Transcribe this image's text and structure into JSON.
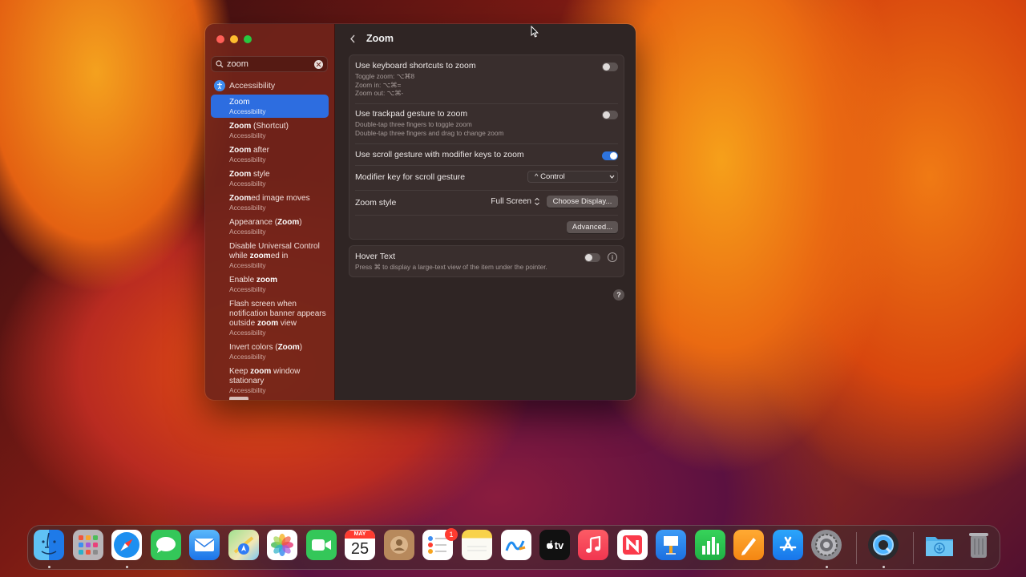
{
  "sidebar": {
    "search": {
      "value": "zoom",
      "placeholder": "Search"
    },
    "category": "Accessibility",
    "results": [
      {
        "title_parts": [
          "Zoom"
        ],
        "bold_idx": [],
        "subtitle": "Accessibility",
        "selected": true
      },
      {
        "title_parts": [
          "Zoom",
          " (Shortcut)"
        ],
        "bold_idx": [
          0
        ],
        "subtitle": "Accessibility"
      },
      {
        "title_parts": [
          "Zoom",
          " after"
        ],
        "bold_idx": [
          0
        ],
        "subtitle": "Accessibility"
      },
      {
        "title_parts": [
          "Zoom",
          " style"
        ],
        "bold_idx": [
          0
        ],
        "subtitle": "Accessibility"
      },
      {
        "title_parts": [
          "Zoom",
          "ed image moves"
        ],
        "bold_idx": [
          0
        ],
        "subtitle": "Accessibility"
      },
      {
        "title_parts": [
          "Appearance (",
          "Zoom",
          ")"
        ],
        "bold_idx": [
          1
        ],
        "subtitle": "Accessibility"
      },
      {
        "title_parts": [
          "Disable Universal Control while ",
          "zoom",
          "ed in"
        ],
        "bold_idx": [
          1
        ],
        "subtitle": "Accessibility"
      },
      {
        "title_parts": [
          "Enable ",
          "zoom"
        ],
        "bold_idx": [
          1
        ],
        "subtitle": "Accessibility"
      },
      {
        "title_parts": [
          "Flash screen when notification banner appears outside ",
          "zoom",
          " view"
        ],
        "bold_idx": [
          1
        ],
        "subtitle": "Accessibility"
      },
      {
        "title_parts": [
          "Invert colors (",
          "Zoom",
          ")"
        ],
        "bold_idx": [
          1
        ],
        "subtitle": "Accessibility"
      },
      {
        "title_parts": [
          "Keep ",
          "zoom",
          " window stationary"
        ],
        "bold_idx": [
          1
        ],
        "subtitle": "Accessibility"
      }
    ]
  },
  "main": {
    "title": "Zoom",
    "keyboard": {
      "label": "Use keyboard shortcuts to zoom",
      "sub1": "Toggle zoom: ⌥⌘8",
      "sub2": "Zoom in: ⌥⌘=",
      "sub3": "Zoom out: ⌥⌘-",
      "on": false
    },
    "trackpad": {
      "label": "Use trackpad gesture to zoom",
      "sub1": "Double-tap three fingers to toggle zoom",
      "sub2": "Double-tap three fingers and drag to change zoom",
      "on": false
    },
    "scroll": {
      "label": "Use scroll gesture with modifier keys to zoom",
      "on": true
    },
    "modifier": {
      "label": "Modifier key for scroll gesture",
      "value": "^ Control"
    },
    "style": {
      "label": "Zoom style",
      "value": "Full Screen",
      "button": "Choose Display..."
    },
    "advanced_button": "Advanced...",
    "hover": {
      "label": "Hover Text",
      "sub": "Press ⌘ to display a large-text view of the item under the pointer.",
      "on": false
    },
    "help": "?"
  },
  "dock": {
    "calendar": {
      "month": "MAY",
      "day": "25"
    },
    "reminders_badge": "1",
    "tv_label": "tv",
    "items": [
      "Finder",
      "Launchpad",
      "Safari",
      "Messages",
      "Mail",
      "Maps",
      "Photos",
      "FaceTime",
      "Calendar",
      "Contacts",
      "Reminders",
      "Notes",
      "Freeform",
      "TV",
      "Music",
      "News",
      "Keynote",
      "Numbers",
      "Pages",
      "App Store",
      "System Settings",
      "QuickTime Player",
      "Downloads",
      "Trash"
    ]
  },
  "colors": {
    "accent": "#2d6de0",
    "sidebar": "#70241a",
    "panel": "#2f2524"
  }
}
